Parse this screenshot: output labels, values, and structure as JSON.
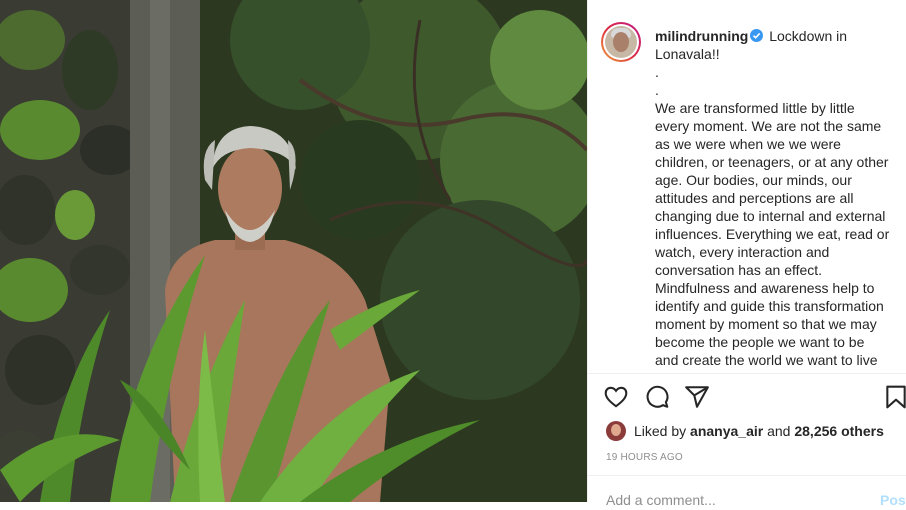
{
  "post": {
    "username": "milindrunning",
    "verified": true,
    "caption_head": "Lockdown in Lonavala!!",
    "caption_dots": [
      ".",
      "."
    ],
    "caption_body": "We are transformed little by little every moment. We are not the same as we were when we we were children, or teenagers, or at any other age. Our bodies, our minds, our attitudes and perceptions are all changing due to internal and external influences. Everything we eat, read or watch, every interaction and conversation has an effect. Mindfulness and awareness help to identify and guide this transformation moment by moment so that we may become the people we want to be and create the world we want to live in. Stay positive. Love"
  },
  "likes": {
    "prefix": "Liked by",
    "liker": "ananya_air",
    "joiner": "and",
    "others": "28,256 others"
  },
  "timestamp": "19 HOURS AGO",
  "comment": {
    "placeholder": "Add a comment...",
    "post_label": "Post"
  },
  "icons": {
    "like": "heart-icon",
    "comment": "comment-icon",
    "share": "share-icon",
    "save": "bookmark-icon"
  },
  "colors": {
    "verified_blue": "#3897f0",
    "muted": "#8e8e8e",
    "post_button_disabled": "#b2dffc"
  }
}
